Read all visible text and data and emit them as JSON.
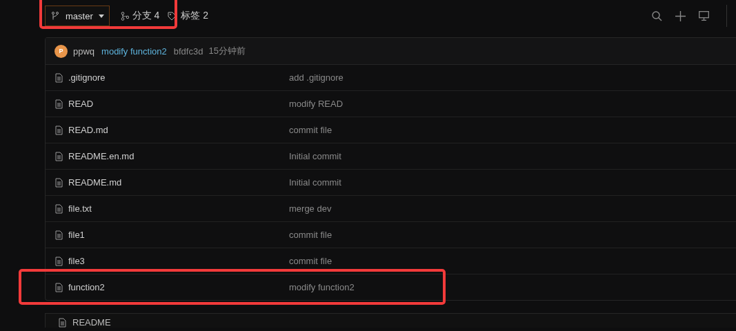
{
  "branch_bar": {
    "branch": "master",
    "branches": "分支 4",
    "tags": "标签 2",
    "highlighted": true
  },
  "latest_commit": {
    "avatar": "P",
    "author": "ppwq",
    "message": "modify function2",
    "sha": "bfdfc3d",
    "time": "15分钟前"
  },
  "files": [
    {
      "name": ".gitignore",
      "message": "add .gitignore",
      "highlighted": false
    },
    {
      "name": "READ",
      "message": "modify READ",
      "highlighted": false
    },
    {
      "name": "READ.md",
      "message": "commit file",
      "highlighted": false
    },
    {
      "name": "README.en.md",
      "message": "Initial commit",
      "highlighted": false
    },
    {
      "name": "README.md",
      "message": "Initial commit",
      "highlighted": false
    },
    {
      "name": "file.txt",
      "message": "merge dev",
      "highlighted": false
    },
    {
      "name": "file1",
      "message": "commit file",
      "highlighted": false
    },
    {
      "name": "file3",
      "message": "commit file",
      "highlighted": false
    },
    {
      "name": "function2",
      "message": "modify function2",
      "highlighted": true
    }
  ],
  "readme": {
    "title": "README"
  }
}
